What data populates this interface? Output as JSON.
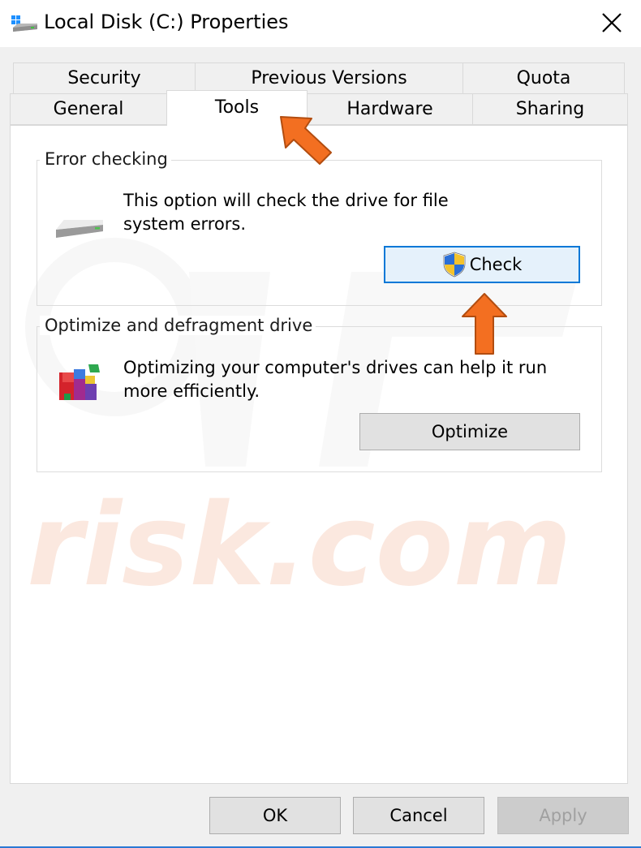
{
  "window": {
    "title": "Local Disk (C:) Properties"
  },
  "tabs": {
    "row_top": [
      {
        "label": "Security"
      },
      {
        "label": "Previous Versions"
      },
      {
        "label": "Quota"
      }
    ],
    "row_bottom": [
      {
        "label": "General"
      },
      {
        "label": "Tools",
        "active": true
      },
      {
        "label": "Hardware"
      },
      {
        "label": "Sharing"
      }
    ]
  },
  "error_checking": {
    "group_label": "Error checking",
    "description_line1": "This option will check the drive for file",
    "description_line2": "system errors.",
    "button_label": "Check",
    "icon": "drive-icon",
    "button_icon": "uac-shield-icon"
  },
  "optimize": {
    "group_label": "Optimize and defragment drive",
    "description_line1": "Optimizing your computer's drives can help it run",
    "description_line2": "more efficiently.",
    "button_label": "Optimize",
    "icon": "defrag-icon"
  },
  "footer": {
    "ok_label": "OK",
    "cancel_label": "Cancel",
    "apply_label": "Apply"
  },
  "watermark": {
    "text": "risk.com"
  },
  "colors": {
    "accent": "#0078d7",
    "annotation_arrow": "#f36f21",
    "watermark": "#fbe8df"
  }
}
